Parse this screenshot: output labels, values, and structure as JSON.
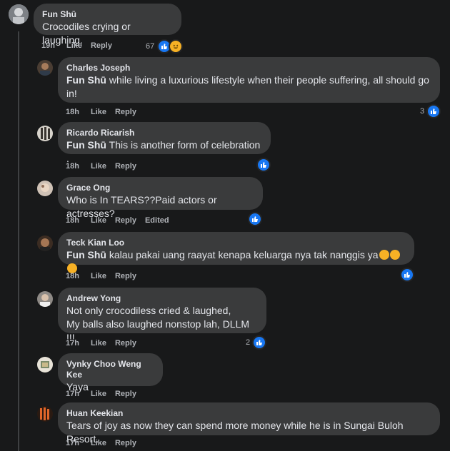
{
  "comments": [
    {
      "author": "Fun Shū",
      "mention": "",
      "text": "Crocodiles crying or laughing.",
      "time": "19h",
      "like": "Like",
      "reply": "Reply",
      "edited": "",
      "count": "67"
    },
    {
      "author": "Charles Joseph",
      "mention": "Fun Shū",
      "text": " while living a luxurious lifestyle when their people suffering, all should go",
      "text2": "in!",
      "time": "18h",
      "like": "Like",
      "reply": "Reply",
      "edited": "",
      "count": "3"
    },
    {
      "author": "Ricardo Ricarish",
      "mention": "Fun Shū",
      "text": " This is another form of celebration .",
      "time": "18h",
      "like": "Like",
      "reply": "Reply",
      "edited": "",
      "count": ""
    },
    {
      "author": "Grace Ong",
      "mention": "",
      "text": "Who is In TEARS??Paid actors or actresses?",
      "time": "18h",
      "like": "Like",
      "reply": "Reply",
      "edited": "Edited",
      "count": ""
    },
    {
      "author": "Teck Kian Loo",
      "mention": "Fun Shū",
      "text": " kalau pakai uang raayat kenapa keluarga nya tak nanggis ya",
      "time": "18h",
      "like": "Like",
      "reply": "Reply",
      "edited": "",
      "count": ""
    },
    {
      "author": "Andrew Yong",
      "mention": "",
      "text": "Not only crocodiless cried & laughed,",
      "text2": "My balls also laughed nonstop lah, DLLM !!!",
      "time": "17h",
      "like": "Like",
      "reply": "Reply",
      "edited": "",
      "count": "2"
    },
    {
      "author": "Vynky Choo Weng Kee",
      "mention": "",
      "text": "Yaya",
      "time": "17h",
      "like": "Like",
      "reply": "Reply",
      "edited": "",
      "count": ""
    },
    {
      "author": "Huan Keekian",
      "mention": "",
      "text": "Tears of joy as now they can spend more money while he is in Sungai Buloh Resort.",
      "time": "17h",
      "like": "Like",
      "reply": "Reply",
      "edited": "",
      "count": ""
    }
  ],
  "colors": {
    "background": "#18191a",
    "bubble": "#3a3b3c",
    "like_blue": "#1877f2",
    "haha_yellow": "#f7b125",
    "muted": "#b0b3b8"
  },
  "icons": {
    "like": "thumbs-up-icon",
    "haha": "laughing-emoji-icon"
  }
}
